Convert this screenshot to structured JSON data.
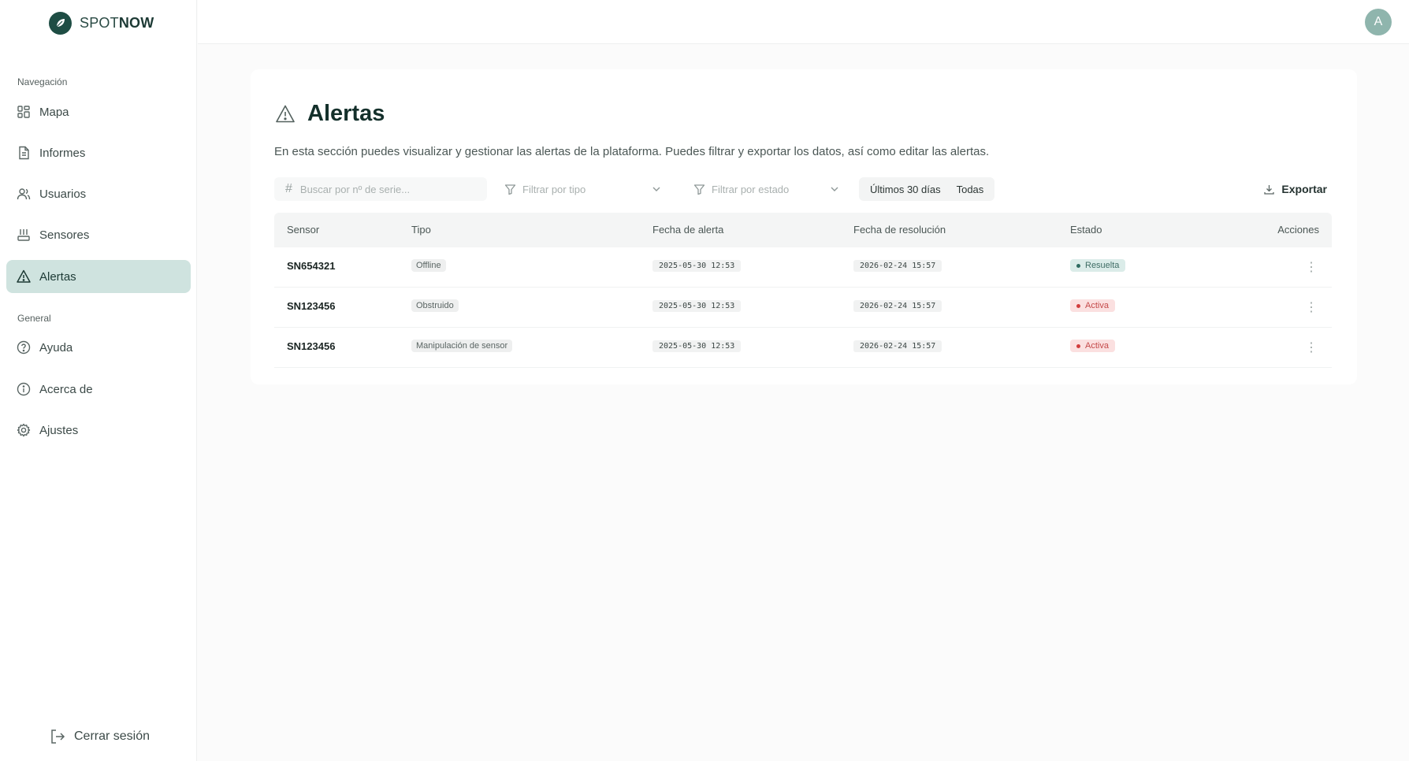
{
  "brand": {
    "name_light": "SPOT",
    "name_bold": "NOW"
  },
  "user": {
    "avatar_initial": "A"
  },
  "sidebar": {
    "nav_heading": "Navegación",
    "nav_items": [
      {
        "label": "Mapa",
        "icon": "grid-icon"
      },
      {
        "label": "Informes",
        "icon": "document-icon"
      },
      {
        "label": "Usuarios",
        "icon": "users-icon"
      },
      {
        "label": "Sensores",
        "icon": "sensor-icon"
      },
      {
        "label": "Alertas",
        "icon": "warning-icon",
        "active": true
      }
    ],
    "general_heading": "General",
    "general_items": [
      {
        "label": "Ayuda",
        "icon": "help-icon"
      },
      {
        "label": "Acerca de",
        "icon": "info-icon"
      },
      {
        "label": "Ajustes",
        "icon": "gear-icon"
      }
    ],
    "logout_label": "Cerrar sesión"
  },
  "page": {
    "title": "Alertas",
    "description": "En esta sección puedes visualizar y gestionar las alertas de la plataforma. Puedes filtrar y exportar los datos, así como editar las alertas."
  },
  "filters": {
    "search_placeholder": "Buscar por nº de serie...",
    "type_placeholder": "Filtrar por tipo",
    "state_placeholder": "Filtrar por estado",
    "range_options": [
      "Últimos 30 días",
      "Todas"
    ],
    "export_label": "Exportar"
  },
  "table": {
    "headers": [
      "Sensor",
      "Tipo",
      "Fecha de alerta",
      "Fecha de resolución",
      "Estado",
      "Acciones"
    ],
    "rows": [
      {
        "sensor": "SN654321",
        "type": "Offline",
        "alert_date": "2025-05-30 12:53",
        "resolution_date": "2026-02-24 15:57",
        "status": "Resuelta",
        "status_kind": "resolved"
      },
      {
        "sensor": "SN123456",
        "type": "Obstruido",
        "alert_date": "2025-05-30 12:53",
        "resolution_date": "2026-02-24 15:57",
        "status": "Activa",
        "status_kind": "active"
      },
      {
        "sensor": "SN123456",
        "type": "Manipulación de sensor",
        "alert_date": "2025-05-30 12:53",
        "resolution_date": "2026-02-24 15:57",
        "status": "Activa",
        "status_kind": "active"
      }
    ]
  },
  "colors": {
    "accent": "#1e4d44",
    "active_nav_bg": "#cfe3df",
    "resolved": "#2f6b61",
    "active_alert": "#d23d3d"
  }
}
